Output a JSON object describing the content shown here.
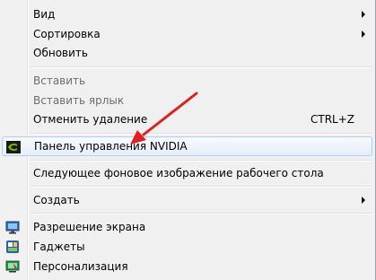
{
  "menu": {
    "items": [
      {
        "label": "Вид"
      },
      {
        "label": "Сортировка"
      },
      {
        "label": "Обновить"
      },
      {
        "label": "Вставить"
      },
      {
        "label": "Вставить ярлык"
      },
      {
        "label": "Отменить удаление",
        "shortcut": "CTRL+Z"
      },
      {
        "label": "Панель управления NVIDIA",
        "icon": "nvidia-icon"
      },
      {
        "label": "Следующее фоновое изображение рабочего стола"
      },
      {
        "label": "Создать"
      },
      {
        "label": "Разрешение экрана",
        "icon": "display-icon"
      },
      {
        "label": "Гаджеты",
        "icon": "gadgets-icon"
      },
      {
        "label": "Персонализация",
        "icon": "personalize-icon"
      }
    ]
  },
  "colors": {
    "annotation_arrow": "#e02020",
    "nvidia_green": "#76b900",
    "highlight_border": "#aecff7"
  }
}
